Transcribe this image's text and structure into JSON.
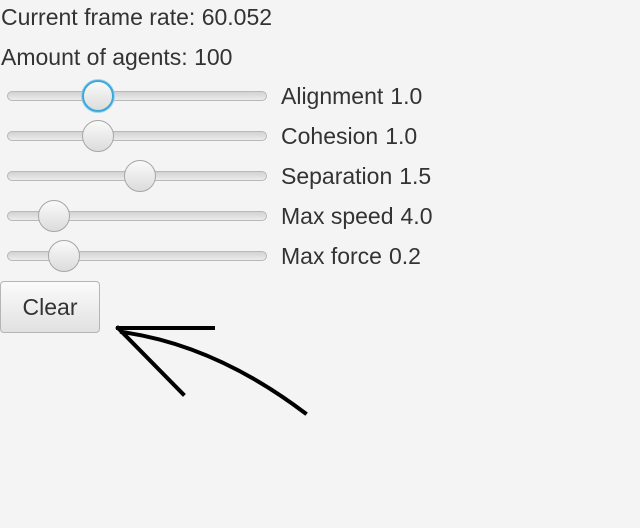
{
  "status": {
    "frame_rate_label": "Current frame rate:",
    "frame_rate_value": "60.052",
    "agents_label": "Amount of agents:",
    "agents_value": "100"
  },
  "sliders": [
    {
      "label": "Alignment",
      "value": "1.0",
      "thumb_fraction": 0.35,
      "focused": true
    },
    {
      "label": "Cohesion",
      "value": "1.0",
      "thumb_fraction": 0.35,
      "focused": false
    },
    {
      "label": "Separation",
      "value": "1.5",
      "thumb_fraction": 0.51,
      "focused": false
    },
    {
      "label": "Max speed",
      "value": "4.0",
      "thumb_fraction": 0.18,
      "focused": false
    },
    {
      "label": "Max force",
      "value": "0.2",
      "thumb_fraction": 0.22,
      "focused": false
    }
  ],
  "buttons": {
    "clear_label": "Clear"
  },
  "colors": {
    "background": "#f4f4f4",
    "text": "#333333",
    "focus_ring": "#3da7d8",
    "annotation": "#000000"
  },
  "icons": {
    "annotation": "hand-drawn-arrow-icon"
  }
}
